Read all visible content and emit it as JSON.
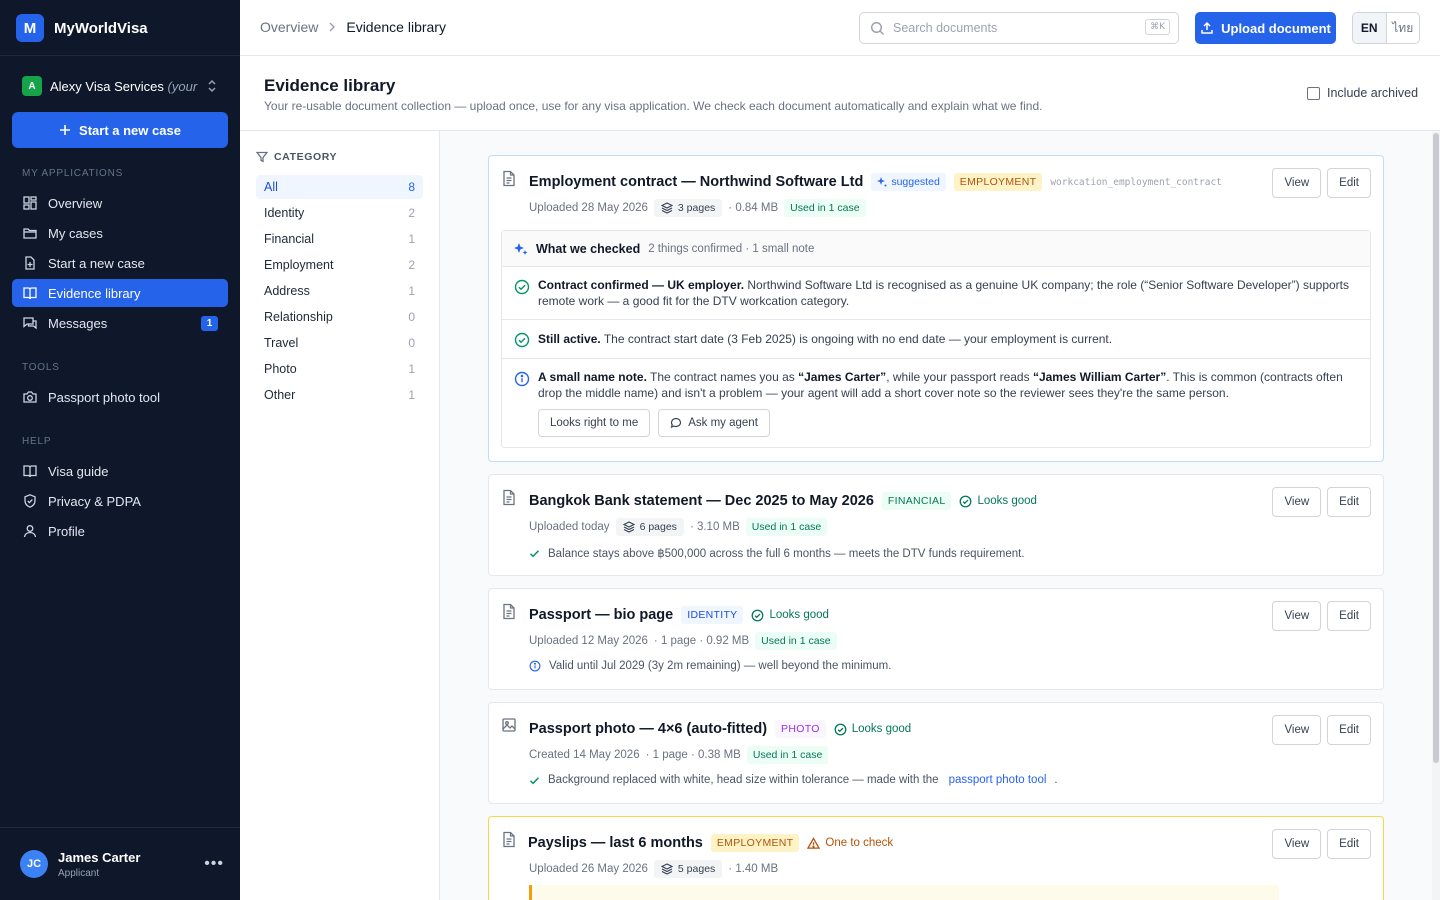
{
  "brand": {
    "logo_letter": "M",
    "name": "MyWorldVisa"
  },
  "org": {
    "badge": "A",
    "name": "Alexy Visa Services",
    "hint": "(your ..."
  },
  "sidebar": {
    "new_case_label": "Start a new case",
    "sections": {
      "applications": "MY APPLICATIONS",
      "tools": "TOOLS",
      "help": "HELP"
    },
    "items": {
      "overview": "Overview",
      "my_cases": "My cases",
      "start_case": "Start a new case",
      "evidence": "Evidence library",
      "messages": "Messages",
      "messages_count": "1",
      "photo_tool": "Passport photo tool",
      "visa_guide": "Visa guide",
      "privacy": "Privacy & PDPA",
      "profile": "Profile"
    },
    "active_item": "evidence"
  },
  "user": {
    "initials": "JC",
    "name": "James Carter",
    "role": "Applicant",
    "more": "•••"
  },
  "header": {
    "breadcrumb": [
      "Overview",
      "Evidence library"
    ],
    "search_placeholder": "Search documents",
    "search_shortcut": "⌘K",
    "upload_label": "Upload document",
    "lang": {
      "en": "EN",
      "th": "ไทย",
      "active": "EN"
    }
  },
  "page": {
    "title": "Evidence library",
    "subtitle": "Your re-usable document collection — upload once, use for any visa application. We check each document automatically and explain what we find.",
    "include_archived": "Include archived"
  },
  "categories": {
    "header": "CATEGORY",
    "items": [
      {
        "label": "All",
        "count": "8"
      },
      {
        "label": "Identity",
        "count": "2"
      },
      {
        "label": "Financial",
        "count": "1"
      },
      {
        "label": "Employment",
        "count": "2"
      },
      {
        "label": "Address",
        "count": "1"
      },
      {
        "label": "Relationship",
        "count": "0"
      },
      {
        "label": "Travel",
        "count": "0"
      },
      {
        "label": "Photo",
        "count": "1"
      },
      {
        "label": "Other",
        "count": "1"
      }
    ]
  },
  "actions": {
    "view": "View",
    "edit": "Edit"
  },
  "documents": [
    {
      "title": "Employment contract — Northwind Software Ltd",
      "suggested": "suggested",
      "tag": "EMPLOYMENT",
      "code": "workcation_employment_contract",
      "uploaded": "Uploaded 28 May 2026",
      "pages": "3 pages",
      "size": "· 0.84 MB",
      "used": "Used in 1 case",
      "checks": {
        "title": "What we checked",
        "summary": "2 things confirmed · 1 small note",
        "items": [
          {
            "bold": "Contract confirmed — UK employer.",
            "text": " Northwind Software Ltd is recognised as a genuine UK company; the role (“Senior Software Developer”) supports remote work — a good fit for the DTV workcation category."
          },
          {
            "bold": "Still active.",
            "text": " The contract start date (3 Feb 2025) is ongoing with no end date — your employment is current."
          },
          {
            "bold": "A small name note.",
            "text_a": " The contract names you as ",
            "name_a": "“James Carter”",
            "text_b": ", while your passport reads ",
            "name_b": "“James William Carter”",
            "text_c": ". This is common (contracts often drop the middle name) and isn't a problem — your agent will add a short cover note so the reviewer sees they're the same person."
          }
        ],
        "looks_right": "Looks right to me",
        "ask_agent": "Ask my agent"
      }
    },
    {
      "title": "Bangkok Bank statement — Dec 2025 to May 2026",
      "tag": "FINANCIAL",
      "status": "Looks good",
      "uploaded": "Uploaded today",
      "pages": "6 pages",
      "size": "· 3.10 MB",
      "used": "Used in 1 case",
      "note": "Balance stays above ฿500,000 across the full 6 months — meets the DTV funds requirement."
    },
    {
      "title": "Passport — bio page",
      "tag": "IDENTITY",
      "status": "Looks good",
      "uploaded": "Uploaded 12 May 2026",
      "pages_size": "· 1 page · 0.92 MB",
      "used": "Used in 1 case",
      "note": "Valid until Jul 2029 (3y 2m remaining) — well beyond the minimum."
    },
    {
      "title": "Passport photo — 4×6 (auto-fitted)",
      "tag": "PHOTO",
      "status": "Looks good",
      "uploaded": "Created 14 May 2026",
      "pages_size": "· 1 page · 0.38 MB",
      "used": "Used in 1 case",
      "note": "Background replaced with white, head size within tolerance — made with the",
      "link": "passport photo tool",
      "note_end": "."
    },
    {
      "title": "Payslips — last 6 months",
      "tag": "EMPLOYMENT",
      "status": "One to check",
      "uploaded": "Uploaded 26 May 2026",
      "pages": "5 pages",
      "size": "· 1.40 MB"
    }
  ],
  "colors": {
    "accent": "#2563eb",
    "sidebar": "#0f172a",
    "success": "#047857",
    "warning": "#b45309"
  }
}
